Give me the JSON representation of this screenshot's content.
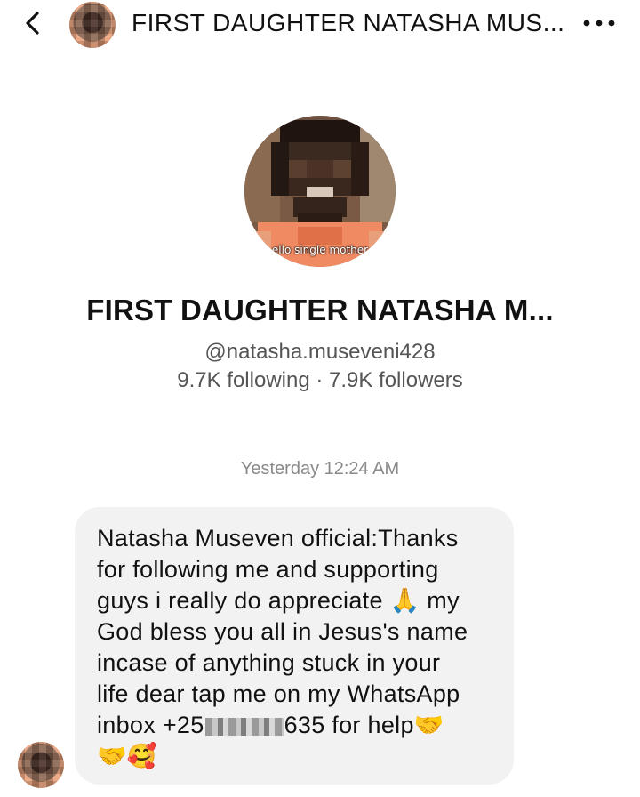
{
  "header": {
    "back_icon": "chevron-left-icon",
    "title": "FIRST DAUGHTER NATASHA MUS...",
    "more_icon": "more-horizontal-icon"
  },
  "profile": {
    "picture_caption": "ello single mother",
    "name": "FIRST DAUGHTER NATASHA M...",
    "handle": "@natasha.museveni428",
    "stats": "9.7K following · 7.9K followers"
  },
  "conversation": {
    "timestamp": "Yesterday 12:24 AM",
    "message": {
      "lines": [
        "Natasha Museven official:Thanks",
        "for following me and supporting",
        "guys i really do appreciate 🙏 my",
        "God bless you all in Jesus's name",
        "incase of anything stuck in your",
        "life dear tap me on my WhatsApp"
      ],
      "phone_prefix": "inbox +25",
      "phone_suffix": "635 for help🤝",
      "last_line": "🤝🥰"
    }
  },
  "colors": {
    "bubble_bg": "#f2f2f2",
    "secondary_text": "#555555",
    "timestamp_text": "#8a8a8a"
  }
}
